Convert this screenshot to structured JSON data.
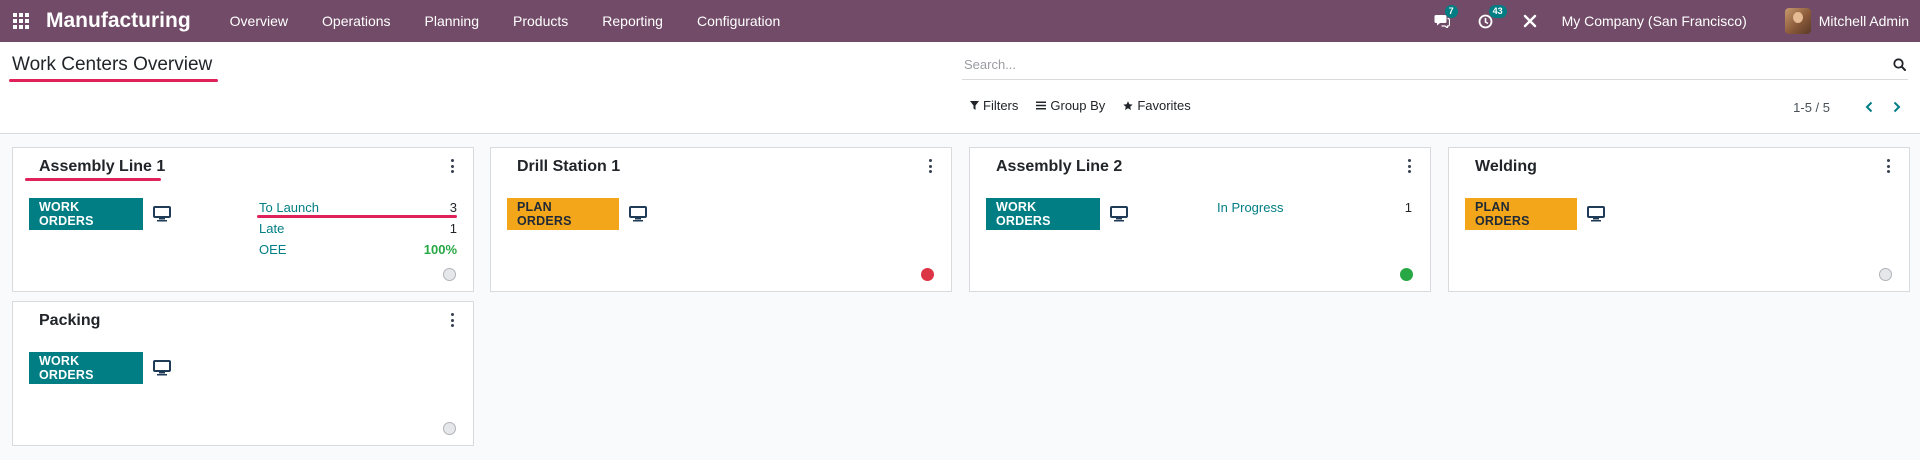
{
  "navbar": {
    "app_name": "Manufacturing",
    "menu": [
      "Overview",
      "Operations",
      "Planning",
      "Products",
      "Reporting",
      "Configuration"
    ],
    "messages_count": "7",
    "activities_count": "43",
    "company": "My Company (San Francisco)",
    "user": "Mitchell Admin"
  },
  "control_panel": {
    "title": "Work Centers Overview",
    "search_placeholder": "Search...",
    "filters_label": "Filters",
    "group_by_label": "Group By",
    "favorites_label": "Favorites",
    "pager": "1-5 / 5"
  },
  "cards": [
    {
      "name": "Assembly Line 1",
      "button": "WORK ORDERS",
      "stats": [
        {
          "label": "To Launch",
          "value": "3"
        },
        {
          "label": "Late",
          "value": "1"
        },
        {
          "label": "OEE",
          "value": "100%"
        }
      ],
      "status": "grey"
    },
    {
      "name": "Drill Station 1",
      "button": "PLAN ORDERS",
      "status": "red"
    },
    {
      "name": "Assembly Line 2",
      "button": "WORK ORDERS",
      "stats": [
        {
          "label": "In Progress",
          "value": "1"
        }
      ],
      "status": "green"
    },
    {
      "name": "Welding",
      "button": "PLAN ORDERS",
      "status": "grey"
    },
    {
      "name": "Packing",
      "button": "WORK ORDERS",
      "status": "grey"
    }
  ],
  "colors": {
    "navbar": "#714b67",
    "primary_button": "#017e84",
    "warning_button": "#f3a619",
    "highlight": "#e0215a",
    "status_red": "#dc3545",
    "status_green": "#28a745"
  }
}
